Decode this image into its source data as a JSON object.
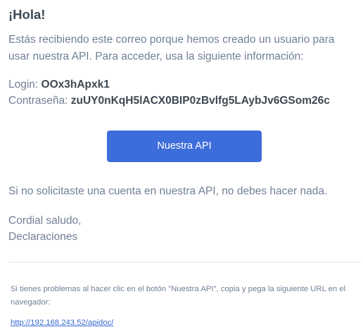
{
  "email": {
    "greeting": "¡Hola!",
    "intro": "Estás recibiendo este correo porque hemos creado un usuario para usar nuestra API. Para acceder, usa la siguiente información:",
    "login_label": "Login:",
    "login_value": "OOx3hApxk1",
    "password_label": "Contraseña:",
    "password_value": "zuUY0nKqH5lACX0BIP0zBvlfg5LAybJv6GSom26c",
    "button_label": "Nuestra API",
    "ignore_text": "Si no solicitaste una cuenta en nuestra API, no debes hacer nada.",
    "closing": "Cordial saludo,",
    "signature": "Declaraciones",
    "trouble_text": "Si tienes problemas al hacer clic en el botón \"Nuestra API\", copia y pega la siguiente URL en el navegador:",
    "url": "http://192.168.243.52/apidoc/"
  },
  "colors": {
    "heading": "#3d4852",
    "body_text": "#718096",
    "button_bg": "#3d6ddb",
    "link": "#3869d4",
    "divider": "#e8e5ef"
  }
}
